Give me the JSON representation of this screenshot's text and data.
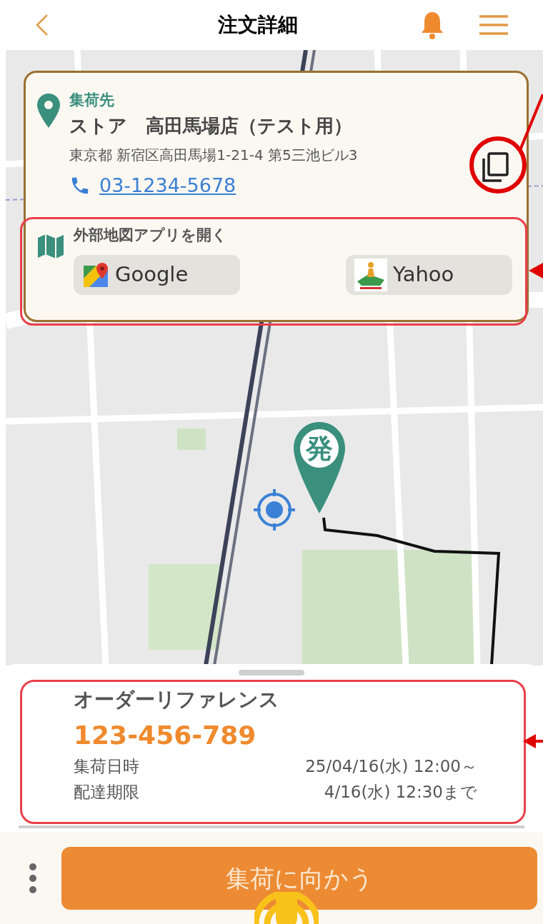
{
  "header": {
    "title": "注文詳細"
  },
  "pickup": {
    "label": "集荷先",
    "name": "ストア　高田馬場店（テスト用）",
    "address": "東京都 新宿区高田馬場1-21-4 第5三池ビル3",
    "phone": "03-1234-5678"
  },
  "external_maps": {
    "label": "外部地図アプリを開く",
    "apps": [
      {
        "kind": "google",
        "label": "Google"
      },
      {
        "kind": "yahoo",
        "label": "Yahoo"
      }
    ]
  },
  "map": {
    "marker": "発"
  },
  "order": {
    "label": "オーダーリファレンス",
    "reference": "123-456-789",
    "rows": [
      {
        "label": "集荷日時",
        "value": "25/04/16(水) 12:00～"
      },
      {
        "label": "配達期限",
        "value": "4/16(水) 12:30まで"
      }
    ]
  },
  "action": {
    "label": "集荷に向かう"
  }
}
